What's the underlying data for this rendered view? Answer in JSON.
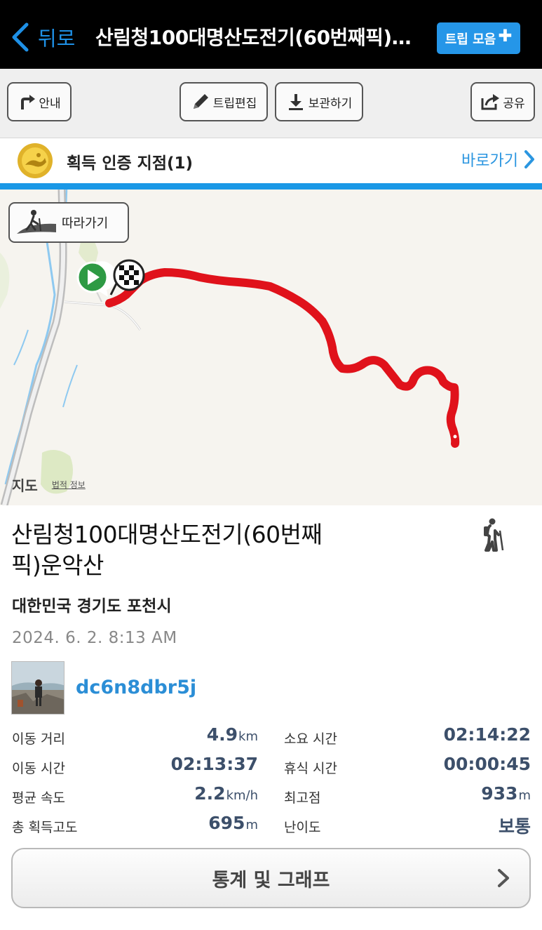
{
  "nav": {
    "back_label": "뒤로",
    "title": "산림청100대명산도전기(60번째픽)운악산",
    "trip_collect_label": "트립 모음"
  },
  "toolbar": {
    "guide_label": "안내",
    "edit_label": "트립편집",
    "save_label": "보관하기",
    "share_label": "공유"
  },
  "certification": {
    "title": "획득 인증 지점(1)",
    "go_label": "바로가기"
  },
  "map": {
    "follow_label": "따라가기",
    "attribution": "지도",
    "legal_label": "법적 정보",
    "route_color": "#e0121b"
  },
  "trip": {
    "title": "산림청100대명산도전기(60번째픽)운악산",
    "location": "대한민국 경기도 포천시",
    "datetime": "2024. 6. 2. 8:13 AM",
    "username": "dc6n8dbr5j",
    "activity_icon": "hiking-icon"
  },
  "stats": {
    "distance": {
      "label": "이동 거리",
      "value": "4.9",
      "unit": "km"
    },
    "total_time": {
      "label": "소요 시간",
      "value": "02:14:22",
      "unit": ""
    },
    "moving_time": {
      "label": "이동 시간",
      "value": "02:13:37",
      "unit": ""
    },
    "rest_time": {
      "label": "휴식 시간",
      "value": "00:00:45",
      "unit": ""
    },
    "avg_speed": {
      "label": "평균 속도",
      "value": "2.2",
      "unit": "km/h"
    },
    "max_elevation": {
      "label": "최고점",
      "value": "933",
      "unit": "m"
    },
    "total_ascent": {
      "label": "총 획득고도",
      "value": "695",
      "unit": "m"
    },
    "difficulty": {
      "label": "난이도",
      "value": "보통",
      "unit": ""
    }
  },
  "graph_button": {
    "label": "통계 및 그래프"
  },
  "colors": {
    "accent": "#1e90e6",
    "value_text": "#3c4f6a"
  }
}
